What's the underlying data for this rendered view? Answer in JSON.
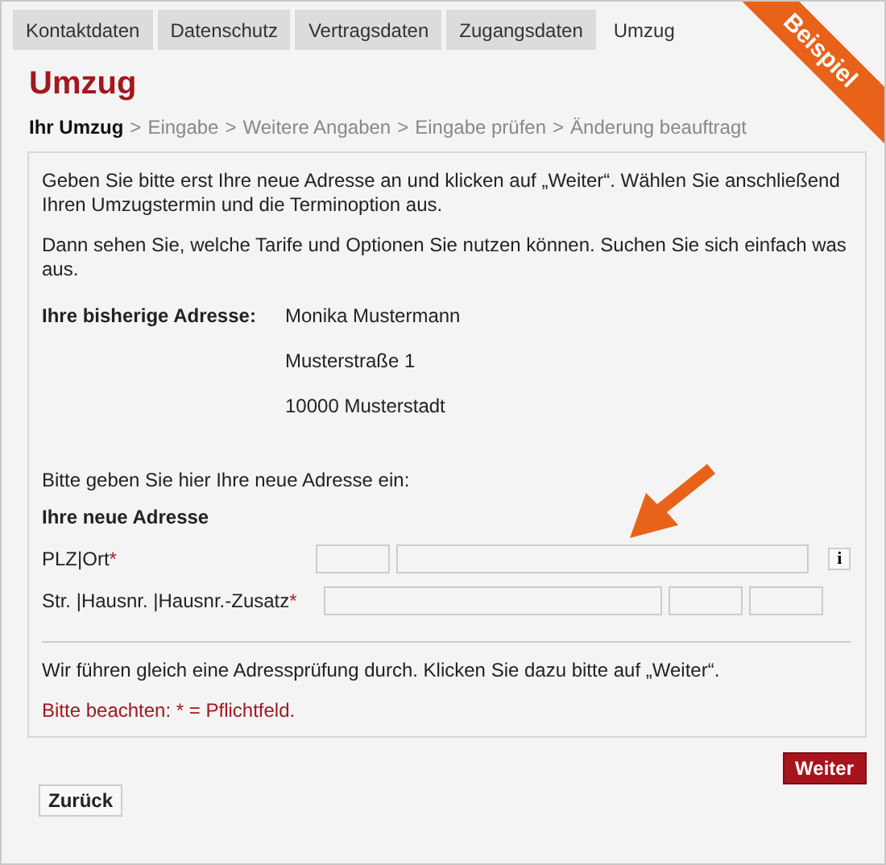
{
  "tabs": [
    {
      "label": "Kontaktdaten",
      "selected": false
    },
    {
      "label": "Datenschutz",
      "selected": false
    },
    {
      "label": "Vertragsdaten",
      "selected": false
    },
    {
      "label": "Zugangsdaten",
      "selected": false
    },
    {
      "label": "Umzug",
      "selected": true
    }
  ],
  "ribbon": "Beispiel",
  "title": "Umzug",
  "breadcrumb": {
    "separator": ">",
    "steps": [
      {
        "label": "Ihr Umzug",
        "selected": true
      },
      {
        "label": "Eingabe",
        "selected": false
      },
      {
        "label": "Weitere Angaben",
        "selected": false
      },
      {
        "label": "Eingabe prüfen",
        "selected": false
      },
      {
        "label": "Änderung beauftragt",
        "selected": false
      }
    ]
  },
  "intro": [
    "Geben Sie bitte erst Ihre neue Adresse an und klicken auf  „Weiter“. Wählen Sie anschließend Ihren Umzugstermin und die Terminoption aus.",
    "Dann sehen Sie, welche Tarife und Optionen Sie nutzen können. Suchen Sie sich einfach was aus."
  ],
  "old_address": {
    "label": "Ihre bisherige Adresse:",
    "lines": [
      "Monika Mustermann",
      "Musterstraße 1",
      "10000 Musterstadt"
    ]
  },
  "new_address": {
    "prompt": "Bitte geben Sie hier Ihre neue Adresse ein:",
    "heading": "Ihre neue Adresse",
    "rows": [
      {
        "label": "PLZ|Ort",
        "required_mark": "*",
        "fields": [
          {
            "kind": "short"
          },
          {
            "kind": "long"
          }
        ],
        "info": "i"
      },
      {
        "label": "Str. |Hausnr. |Hausnr.-Zusatz",
        "required_mark": "*",
        "fields": [
          {
            "kind": "long"
          },
          {
            "kind": "short"
          },
          {
            "kind": "short"
          }
        ]
      }
    ]
  },
  "check_note": "Wir führen gleich eine Adressprüfung durch. Klicken Sie dazu bitte auf „Weiter“.",
  "required_note": "Bitte beachten: * = Pflichtfeld.",
  "buttons": {
    "next": "Weiter",
    "back": "Zurück"
  }
}
